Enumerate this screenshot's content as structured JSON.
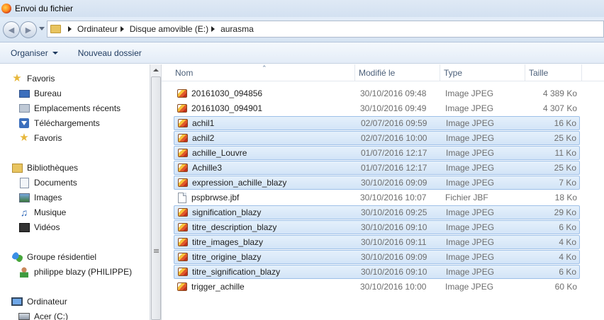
{
  "window": {
    "title": "Envoi du fichier"
  },
  "address": {
    "breadcrumbs": [
      "Ordinateur",
      "Disque amovible (E:)",
      "aurasma"
    ]
  },
  "toolbar": {
    "organise_label": "Organiser",
    "new_folder_label": "Nouveau dossier"
  },
  "nav": {
    "favorites": {
      "label": "Favoris",
      "items": [
        "Bureau",
        "Emplacements récents",
        "Téléchargements",
        "Favoris"
      ]
    },
    "libraries": {
      "label": "Bibliothèques",
      "items": [
        "Documents",
        "Images",
        "Musique",
        "Vidéos"
      ]
    },
    "homegroup": {
      "label": "Groupe résidentiel",
      "items": [
        "philippe blazy (PHILIPPE)"
      ]
    },
    "computer": {
      "label": "Ordinateur",
      "items": [
        "Acer (C:)"
      ]
    }
  },
  "columns": {
    "name": "Nom",
    "modified": "Modifié le",
    "type": "Type",
    "size": "Taille"
  },
  "files": [
    {
      "name": "20161030_094856",
      "date": "30/10/2016 09:48",
      "type": "Image JPEG",
      "size": "4 389 Ko",
      "icon": "jpeg-icon",
      "selected": false
    },
    {
      "name": "20161030_094901",
      "date": "30/10/2016 09:49",
      "type": "Image JPEG",
      "size": "4 307 Ko",
      "icon": "jpeg-icon",
      "selected": false
    },
    {
      "name": "achil1",
      "date": "02/07/2016 09:59",
      "type": "Image JPEG",
      "size": "16 Ko",
      "icon": "jpeg-icon",
      "selected": true
    },
    {
      "name": "achil2",
      "date": "02/07/2016 10:00",
      "type": "Image JPEG",
      "size": "25 Ko",
      "icon": "jpeg-icon",
      "selected": true
    },
    {
      "name": "achille_Louvre",
      "date": "01/07/2016 12:17",
      "type": "Image JPEG",
      "size": "11 Ko",
      "icon": "jpeg-icon",
      "selected": true
    },
    {
      "name": "Achille3",
      "date": "01/07/2016 12:17",
      "type": "Image JPEG",
      "size": "25 Ko",
      "icon": "jpeg-icon",
      "selected": true
    },
    {
      "name": "expression_achille_blazy",
      "date": "30/10/2016 09:09",
      "type": "Image JPEG",
      "size": "7 Ko",
      "icon": "jpeg-icon",
      "selected": true
    },
    {
      "name": "pspbrwse.jbf",
      "date": "30/10/2016 10:07",
      "type": "Fichier JBF",
      "size": "18 Ko",
      "icon": "file-icon",
      "selected": false
    },
    {
      "name": "signification_blazy",
      "date": "30/10/2016 09:25",
      "type": "Image JPEG",
      "size": "29 Ko",
      "icon": "jpeg-icon",
      "selected": true
    },
    {
      "name": "titre_description_blazy",
      "date": "30/10/2016 09:10",
      "type": "Image JPEG",
      "size": "6 Ko",
      "icon": "jpeg-icon",
      "selected": true
    },
    {
      "name": "titre_images_blazy",
      "date": "30/10/2016 09:11",
      "type": "Image JPEG",
      "size": "4 Ko",
      "icon": "jpeg-icon",
      "selected": true
    },
    {
      "name": "titre_origine_blazy",
      "date": "30/10/2016 09:09",
      "type": "Image JPEG",
      "size": "4 Ko",
      "icon": "jpeg-icon",
      "selected": true
    },
    {
      "name": "titre_signification_blazy",
      "date": "30/10/2016 09:10",
      "type": "Image JPEG",
      "size": "6 Ko",
      "icon": "jpeg-icon",
      "selected": true
    },
    {
      "name": "trigger_achille",
      "date": "30/10/2016 10:00",
      "type": "Image JPEG",
      "size": "60 Ko",
      "icon": "jpeg-icon",
      "selected": false
    }
  ]
}
